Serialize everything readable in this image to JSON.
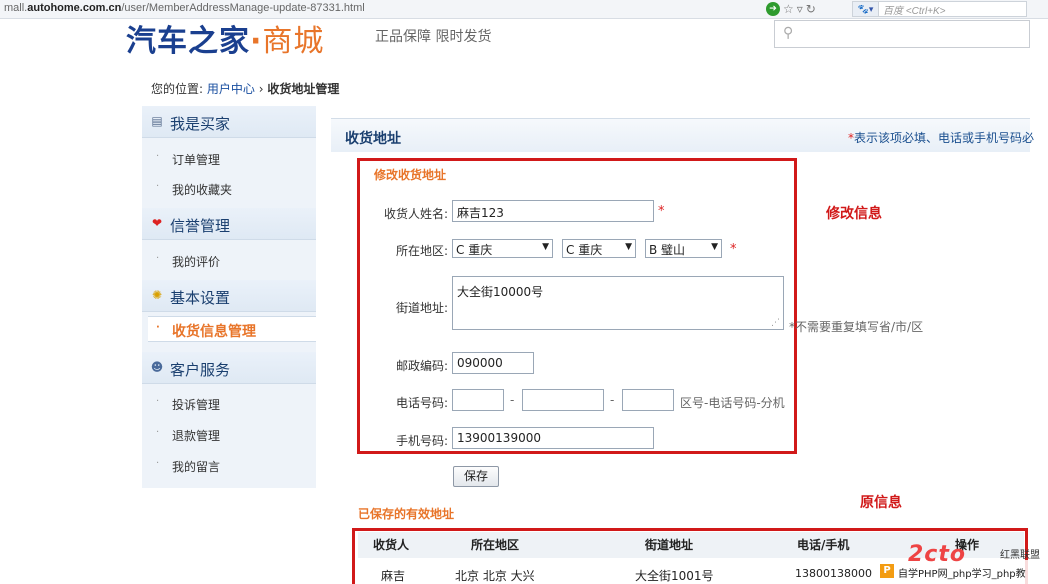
{
  "browser": {
    "url_prefix": "mall.",
    "url_domain": "autohome.com.cn",
    "url_path": "/user/MemberAddressManage-update-87331.html",
    "search_placeholder": "百度 <Ctrl+K>"
  },
  "header": {
    "logo_main": "汽车之家",
    "logo_dot": "·",
    "logo_mall": "商城",
    "slogan": "正品保障  限时发货"
  },
  "breadcrumb": {
    "prefix": "您的位置:",
    "link": "用户中心",
    "sep": "›",
    "current": "收货地址管理"
  },
  "sidebar": {
    "groups": [
      {
        "label": "我是买家",
        "icon": "notepad-icon"
      },
      {
        "label": "信誉管理",
        "icon": "heart-icon"
      },
      {
        "label": "基本设置",
        "icon": "gear-icon"
      },
      {
        "label": "客户服务",
        "icon": "service-person-icon"
      }
    ],
    "items": [
      {
        "label": "订单管理"
      },
      {
        "label": "我的收藏夹"
      },
      {
        "label": "我的评价"
      },
      {
        "label": "收货信息管理"
      },
      {
        "label": "投诉管理"
      },
      {
        "label": "退款管理"
      },
      {
        "label": "我的留言"
      }
    ],
    "bullet": "·",
    "active_bullet": "·"
  },
  "panel": {
    "title": "收货地址",
    "note_star": "*",
    "note_text": "表示该项必填、电话或手机号码必"
  },
  "form": {
    "section_title": "修改收货地址",
    "name_label": "收货人姓名:",
    "name_value": "麻吉123",
    "region_label": "所在地区:",
    "province": "C 重庆",
    "city": "C 重庆",
    "district": "B 璧山",
    "street_label": "街道地址:",
    "street_value": "大全街10000号",
    "street_hint": "不需要重复填写省/市/区",
    "zip_label": "邮政编码:",
    "zip_value": "090000",
    "phone_label": "电话号码:",
    "phone_sep": "-",
    "phone_hint": "区号-电话号码-分机",
    "mobile_label": "手机号码:",
    "mobile_value": "13900139000",
    "required_star": "*",
    "save_label": "保存"
  },
  "annotations": {
    "modify": "修改信息",
    "original": "原信息"
  },
  "saved": {
    "title": "已保存的有效地址",
    "columns": [
      "收货人",
      "所在地区",
      "街道地址",
      "电话/手机",
      "操作"
    ],
    "rows": [
      {
        "name": "麻吉",
        "region": "北京 北京 大兴",
        "street": "大全街1001号",
        "phone": "13800138000"
      }
    ]
  },
  "watermark": {
    "badge": "P",
    "site": "自学PHP网_php学习_php教",
    "brand": "2cto",
    "tag": "红黑联盟"
  }
}
